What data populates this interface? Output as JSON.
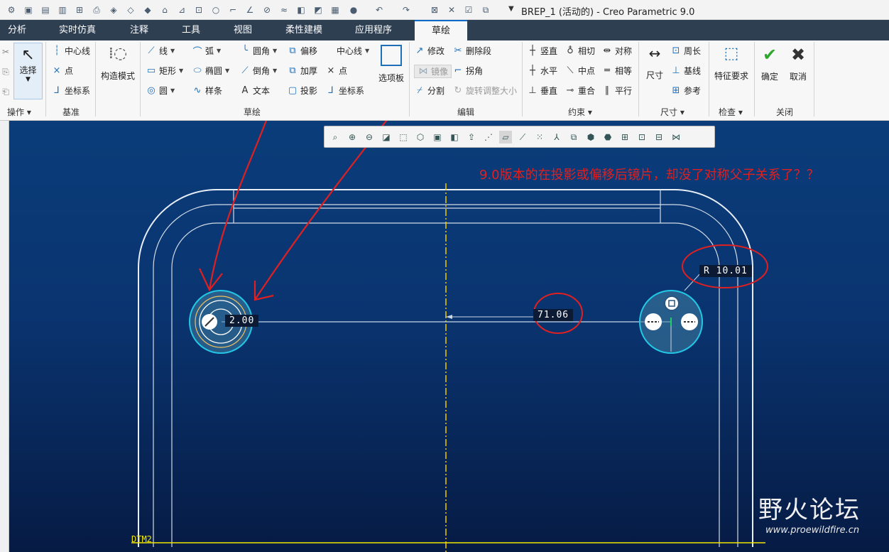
{
  "window": {
    "title": "BREP_1 (活动的) - Creo Parametric 9.0"
  },
  "tabs": [
    {
      "label": "分析",
      "active": false
    },
    {
      "label": "实时仿真",
      "active": false
    },
    {
      "label": "注释",
      "active": false
    },
    {
      "label": "工具",
      "active": false
    },
    {
      "label": "视图",
      "active": false
    },
    {
      "label": "柔性建模",
      "active": false
    },
    {
      "label": "应用程序",
      "active": false
    },
    {
      "label": "草绘",
      "active": true
    }
  ],
  "ribbon": {
    "operations": {
      "select": "选择",
      "label": "操作"
    },
    "datum": {
      "centerline": "中心线",
      "point": "点",
      "csys": "坐标系",
      "label": "基准"
    },
    "construction_mode": "构造模式",
    "sketch": {
      "line": "线",
      "arc": "弧",
      "fillet": "圆角",
      "offset": "偏移",
      "centerline": "中心线",
      "rectangle": "矩形",
      "ellipse": "椭圆",
      "chamfer": "倒角",
      "thicken": "加厚",
      "point": "点",
      "circle": "圆",
      "spline": "样条",
      "text": "文本",
      "project": "投影",
      "csys": "坐标系",
      "palette": "选项板",
      "label": "草绘"
    },
    "edit": {
      "modify": "修改",
      "delete_segment": "删除段",
      "mirror": "镜像",
      "corner": "拐角",
      "divide": "分割",
      "rotate_resize": "旋转调整大小",
      "label": "编辑"
    },
    "constrain": {
      "vertical": "竖直",
      "tangent": "相切",
      "symmetric": "对称",
      "horizontal": "水平",
      "midpoint": "中点",
      "equal": "相等",
      "perpendicular": "垂直",
      "coincident": "重合",
      "parallel": "平行",
      "label": "约束"
    },
    "dimension": {
      "dimension": "尺寸",
      "perimeter": "周长",
      "baseline": "基线",
      "reference": "参考",
      "label": "尺寸"
    },
    "inspect": {
      "feature_requirements": "特征要求",
      "label": "检查"
    },
    "close": {
      "ok": "确定",
      "cancel": "取消",
      "label": "关闭"
    }
  },
  "viewport": {
    "annotation": "9.0版本的在投影或偏移后镜片，却没了对称父子关系了？？",
    "dimensions": {
      "left_dim": "2.00",
      "center_dim": "71.06",
      "radius_dim": "R 10.01"
    },
    "datum_label": "DTM2",
    "watermark": {
      "main": "野火论坛",
      "url": "www.proewildfire.cn"
    }
  },
  "colors": {
    "annotation": "#e02020",
    "tab_bar": "#2f3f52",
    "active_tab_accent": "#0b6bc7",
    "centerline": "#f2e600",
    "highlight_circle": "#22c8e6"
  }
}
